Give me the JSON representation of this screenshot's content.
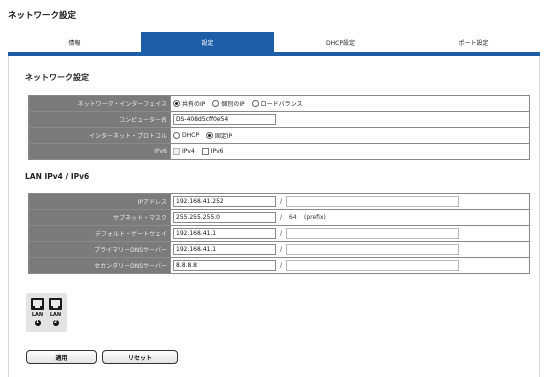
{
  "page": {
    "title": "ネットワーク設定"
  },
  "tabs": [
    {
      "label": "情報",
      "active": false
    },
    {
      "label": "設定",
      "active": true
    },
    {
      "label": "DHCP設定",
      "active": false
    },
    {
      "label": "ポート設定",
      "active": false
    }
  ],
  "network": {
    "section_title": "ネットワーク設定",
    "interface": {
      "label": "ネットワーク・インターフェイス",
      "options": [
        "共有のIP",
        "個別のIP",
        "ロードバランス"
      ],
      "selected": "共有のIP"
    },
    "computer_name": {
      "label": "コンピューター名",
      "value": "DS-408d5cff0e54"
    },
    "protocol": {
      "label": "インターネット・プロトコル",
      "options": [
        "DHCP",
        "固定IP"
      ],
      "selected": "固定IP"
    },
    "ipv6": {
      "label": "IPv6",
      "options": [
        "IPv4",
        "IPv6"
      ]
    }
  },
  "lan": {
    "section_title": "LAN IPv4 / IPv6",
    "rows": [
      {
        "label": "IPアドレス",
        "value": "192.168.41.252",
        "separator": "/",
        "prefix": "",
        "prefix_unit": ""
      },
      {
        "label": "サブネット・マスク",
        "value": "255.255.255.0",
        "separator": "/",
        "prefix": "64",
        "prefix_unit": "(prefix)"
      },
      {
        "label": "デフォルト・ゲートウェイ",
        "value": "192.168.41.1",
        "separator": "/",
        "prefix": "",
        "prefix_unit": ""
      },
      {
        "label": "プライマリーDNSサーバー",
        "value": "192.168.41.1",
        "separator": "/",
        "prefix": "",
        "prefix_unit": ""
      },
      {
        "label": "セカンダリーDNSサーバー",
        "value": "8.8.8.8",
        "separator": "/",
        "prefix": "",
        "prefix_unit": ""
      }
    ]
  },
  "ports": [
    {
      "label": "LAN",
      "number": "1",
      "icon": "ethernet-port-icon"
    },
    {
      "label": "LAN",
      "number": "2",
      "icon": "ethernet-port-icon"
    }
  ],
  "buttons": {
    "apply": "適用",
    "reset": "リセット"
  },
  "colors": {
    "accent": "#1e5ea7",
    "label_bg": "#7b7b7b",
    "label_text": "#e9e9e9",
    "port_bg": "#e3e3e3"
  }
}
